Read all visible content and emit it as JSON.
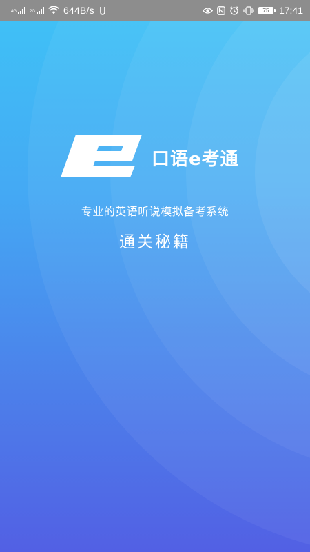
{
  "status_bar": {
    "net_type_1": "4G",
    "net_type_2": "2G",
    "speed": "644B/s",
    "battery_level": "75",
    "time": "17:41",
    "icons": [
      "signal-icon",
      "signal-icon",
      "wifi-icon",
      "usb-debug-icon",
      "eye-icon",
      "nfc-icon",
      "alarm-icon",
      "vibrate-icon",
      "battery-icon"
    ]
  },
  "splash": {
    "app_name": "口语e考通",
    "tagline": "专业的英语听说模拟备考系统",
    "slogan": "通关秘籍",
    "logo_icon": "e-logo-icon"
  },
  "colors": {
    "gradient_top": "#3FC3F6",
    "gradient_bottom": "#5260E4",
    "status_bar_bg": "#8d8d8d",
    "text": "#ffffff"
  }
}
